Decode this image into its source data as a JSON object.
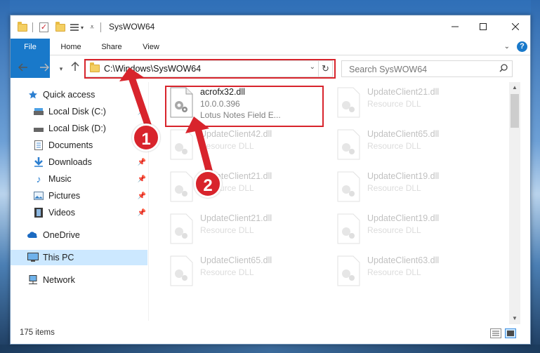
{
  "window": {
    "title": "SysWOW64"
  },
  "ribbon": {
    "tabs": [
      "File",
      "Home",
      "Share",
      "View"
    ]
  },
  "navigation": {
    "address": "C:\\Windows\\SysWOW64",
    "search_placeholder": "Search SysWOW64"
  },
  "sidebar": {
    "items": [
      {
        "label": "Quick access",
        "icon": "star-icon"
      },
      {
        "label": "Local Disk (C:)",
        "icon": "drive-icon",
        "pinned": true
      },
      {
        "label": "Local Disk (D:)",
        "icon": "drive-icon",
        "pinned": true
      },
      {
        "label": "Documents",
        "icon": "documents-icon",
        "pinned": true
      },
      {
        "label": "Downloads",
        "icon": "download-icon",
        "pinned": true
      },
      {
        "label": "Music",
        "icon": "music-icon",
        "pinned": true
      },
      {
        "label": "Pictures",
        "icon": "pictures-icon",
        "pinned": true
      },
      {
        "label": "Videos",
        "icon": "videos-icon",
        "pinned": true
      },
      {
        "label": "OneDrive",
        "icon": "cloud-icon"
      },
      {
        "label": "This PC",
        "icon": "pc-icon",
        "selected": true
      },
      {
        "label": "Network",
        "icon": "network-icon"
      }
    ]
  },
  "files": [
    {
      "name": "acrofx32.dll",
      "line2": "10.0.0.396",
      "line3": "Lotus Notes Field E..."
    },
    {
      "name": "UpdateClient21.dll",
      "line2": "Resource DLL"
    },
    {
      "name": "UpdateClient42.dll",
      "line2": "Resource DLL"
    },
    {
      "name": "UpdateClient65.dll",
      "line2": "Resource DLL"
    },
    {
      "name": "UpdateClient21.dll",
      "line2": "Resource DLL"
    },
    {
      "name": "UpdateClient19.dll",
      "line2": "Resource DLL"
    },
    {
      "name": "UpdateClient21.dll",
      "line2": "Resource DLL"
    },
    {
      "name": "UpdateClient19.dll",
      "line2": "Resource DLL"
    },
    {
      "name": "UpdateClient65.dll",
      "line2": "Resource DLL"
    },
    {
      "name": "UpdateClient63.dll",
      "line2": "Resource DLL"
    }
  ],
  "status": {
    "item_count": "175 items"
  },
  "annotations": {
    "callout_1": "1",
    "callout_2": "2",
    "color": "#d8242c"
  },
  "colors": {
    "accent": "#1979ca",
    "selection": "#cce8ff"
  }
}
